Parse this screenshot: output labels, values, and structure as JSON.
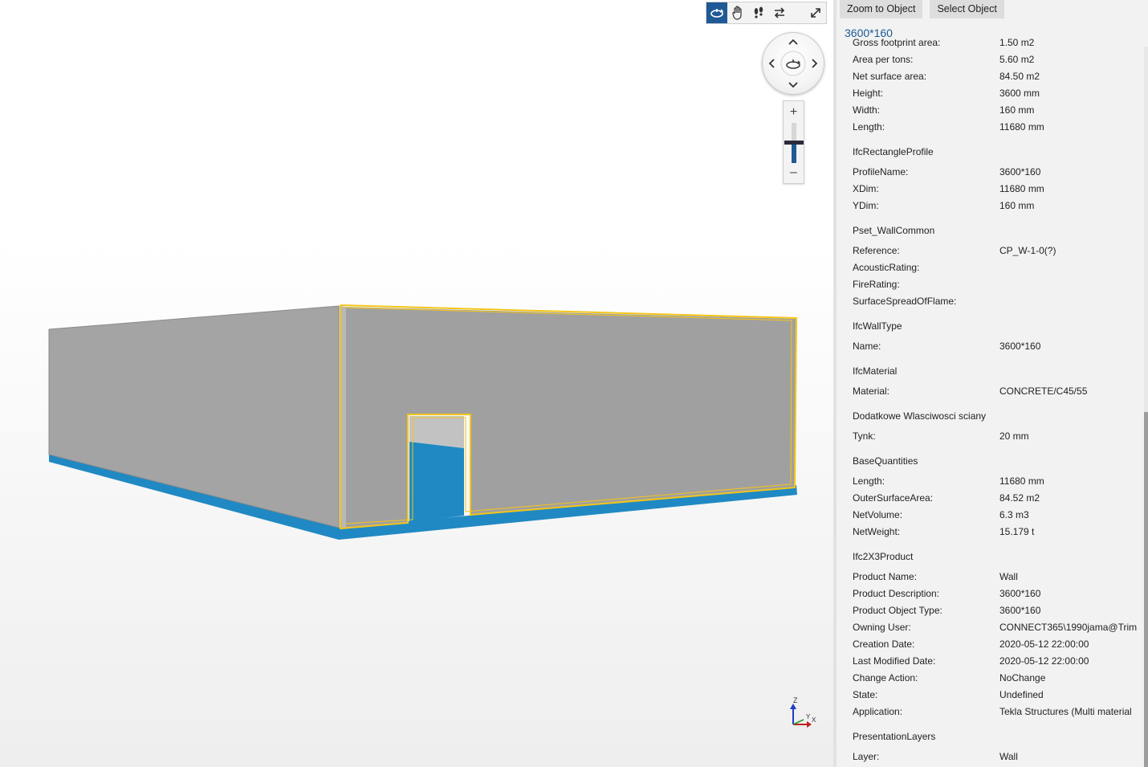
{
  "toolbar": {
    "tools": [
      "orbit-icon",
      "pan-icon",
      "walk-icon",
      "swap-icon",
      "fullscreen-icon"
    ],
    "accent": "#1f5a96"
  },
  "zoom": {
    "plus_label": "+",
    "minus_label": "–",
    "level": 0.5
  },
  "axes": {
    "z_label": "Z",
    "x_label": "X",
    "y_label": "Y"
  },
  "model": {
    "wall_color": "#a0a0a0",
    "slab_color": "#2089c3",
    "highlight_color": "#f5c518"
  },
  "panel": {
    "actions": {
      "zoom_label": "Zoom to Object",
      "select_label": "Select Object"
    },
    "title": "3600*160",
    "clipped_row": {
      "name": "Gross footprint area:",
      "value": "1.50 m2"
    },
    "rows_top": [
      {
        "name": "Area per tons:",
        "value": "5.60 m2"
      },
      {
        "name": "Net surface area:",
        "value": "84.50 m2"
      },
      {
        "name": "Height:",
        "value": "3600 mm"
      },
      {
        "name": "Width:",
        "value": "160 mm"
      },
      {
        "name": "Length:",
        "value": "11680 mm"
      }
    ],
    "groups": [
      {
        "title": "IfcRectangleProfile",
        "rows": [
          {
            "name": "ProfileName:",
            "value": "3600*160"
          },
          {
            "name": "XDim:",
            "value": "11680 mm"
          },
          {
            "name": "YDim:",
            "value": "160 mm"
          }
        ]
      },
      {
        "title": "Pset_WallCommon",
        "rows": [
          {
            "name": "Reference:",
            "value": "CP_W-1-0(?)"
          },
          {
            "name": "AcousticRating:",
            "value": ""
          },
          {
            "name": "FireRating:",
            "value": ""
          },
          {
            "name": "SurfaceSpreadOfFlame:",
            "value": ""
          }
        ]
      },
      {
        "title": "IfcWallType",
        "rows": [
          {
            "name": "Name:",
            "value": "3600*160"
          }
        ]
      },
      {
        "title": "IfcMaterial",
        "rows": [
          {
            "name": "Material:",
            "value": "CONCRETE/C45/55"
          }
        ]
      },
      {
        "title": "Dodatkowe Wlasciwosci sciany",
        "rows": [
          {
            "name": "Tynk:",
            "value": "20 mm"
          }
        ]
      },
      {
        "title": "BaseQuantities",
        "rows": [
          {
            "name": "Length:",
            "value": "11680 mm"
          },
          {
            "name": "OuterSurfaceArea:",
            "value": "84.52 m2"
          },
          {
            "name": "NetVolume:",
            "value": "6.3 m3"
          },
          {
            "name": "NetWeight:",
            "value": "15.179 t"
          }
        ]
      },
      {
        "title": "Ifc2X3Product",
        "rows": [
          {
            "name": "Product Name:",
            "value": "Wall"
          },
          {
            "name": "Product Description:",
            "value": "3600*160"
          },
          {
            "name": "Product Object Type:",
            "value": "3600*160"
          },
          {
            "name": "Owning User:",
            "value": "CONNECT365\\1990jama@Trim"
          },
          {
            "name": "Creation Date:",
            "value": "2020-05-12 22:00:00"
          },
          {
            "name": "Last Modified Date:",
            "value": "2020-05-12 22:00:00"
          },
          {
            "name": "Change Action:",
            "value": "NoChange"
          },
          {
            "name": "State:",
            "value": "Undefined"
          },
          {
            "name": "Application:",
            "value": "Tekla Structures (Multi material"
          }
        ]
      },
      {
        "title": "PresentationLayers",
        "rows": [
          {
            "name": "Layer:",
            "value": "Wall"
          }
        ]
      }
    ]
  }
}
